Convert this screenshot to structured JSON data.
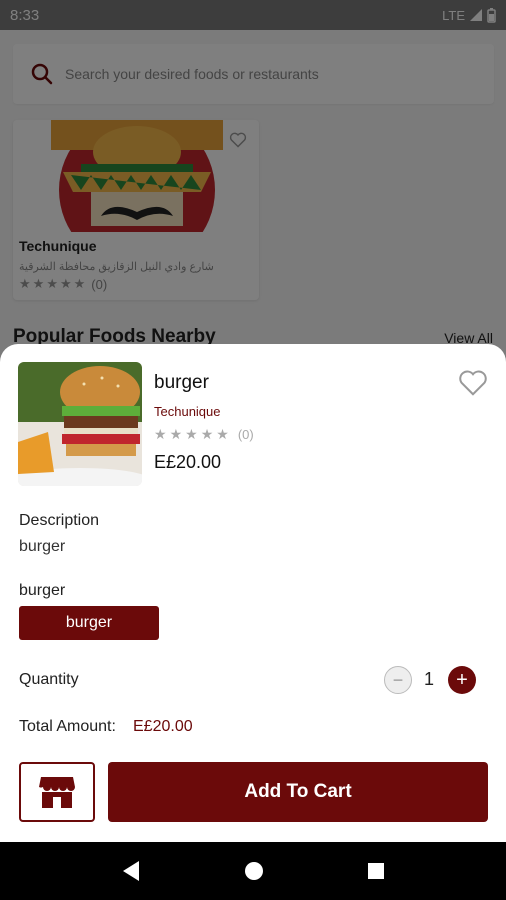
{
  "status_bar": {
    "time": "8:33",
    "network": "LTE"
  },
  "search": {
    "placeholder": "Search your desired foods or restaurants"
  },
  "restaurant_card": {
    "name": "Techunique",
    "address": "شارع وادي النيل الزقازيق محافظة الشرقية",
    "rating_count": "(0)"
  },
  "section": {
    "title": "Popular Foods Nearby",
    "view_all": "View All"
  },
  "product": {
    "name": "burger",
    "store": "Techunique",
    "rating_count": "(0)",
    "price": "E£20.00"
  },
  "description": {
    "label": "Description",
    "text": "burger"
  },
  "variation": {
    "label": "burger",
    "option": "burger"
  },
  "quantity": {
    "label": "Quantity",
    "value": "1"
  },
  "total": {
    "label": "Total Amount:",
    "value": "E£20.00"
  },
  "actions": {
    "add_to_cart": "Add To Cart"
  },
  "colors": {
    "accent": "#6b0a0a"
  },
  "icons": [
    "search-icon",
    "heart-icon",
    "star-icon",
    "store-icon",
    "minus-icon",
    "plus-icon",
    "back-icon",
    "home-icon",
    "recents-icon"
  ]
}
